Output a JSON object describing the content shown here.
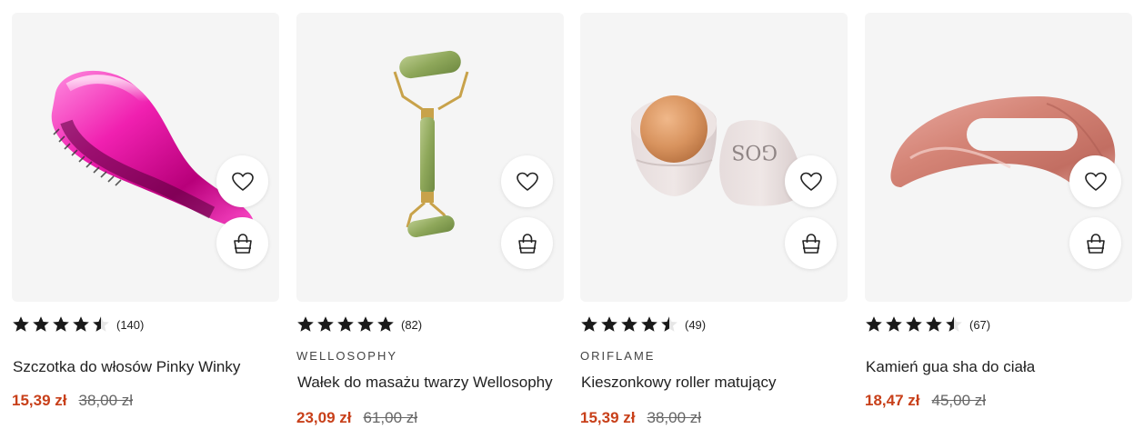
{
  "icons": {
    "wishlist": "heart-icon",
    "cart": "shopping-bag-icon",
    "rating_star": "star-icon"
  },
  "colors": {
    "price": "#c8401a",
    "star": "#1a1a1a",
    "card_background": "#f5f5f5"
  },
  "products": [
    {
      "image": "pink-detangling-hairbrush",
      "brand": "",
      "name": "Szczotka do włosów Pinky Winky",
      "rating": 4.5,
      "review_count": "(140)",
      "price": "15,39 zł",
      "old_price": "38,00 zł"
    },
    {
      "image": "green-jade-face-roller",
      "brand": "WELLOSOPHY",
      "name": "Wałek do masażu twarzy Wellosophy",
      "rating": 5,
      "review_count": "(82)",
      "price": "23,09 zł",
      "old_price": "61,00 zł"
    },
    {
      "image": "matte-roller-pods",
      "brand": "ORIFLAME",
      "name": "Kieszonkowy roller matujący",
      "rating": 4.5,
      "review_count": "(49)",
      "price": "15,39 zł",
      "old_price": "38,00 zł"
    },
    {
      "image": "rose-quartz-gua-sha",
      "brand": "",
      "name": "Kamień gua sha do ciała",
      "rating": 4.5,
      "review_count": "(67)",
      "price": "18,47 zł",
      "old_price": "45,00 zł"
    }
  ]
}
